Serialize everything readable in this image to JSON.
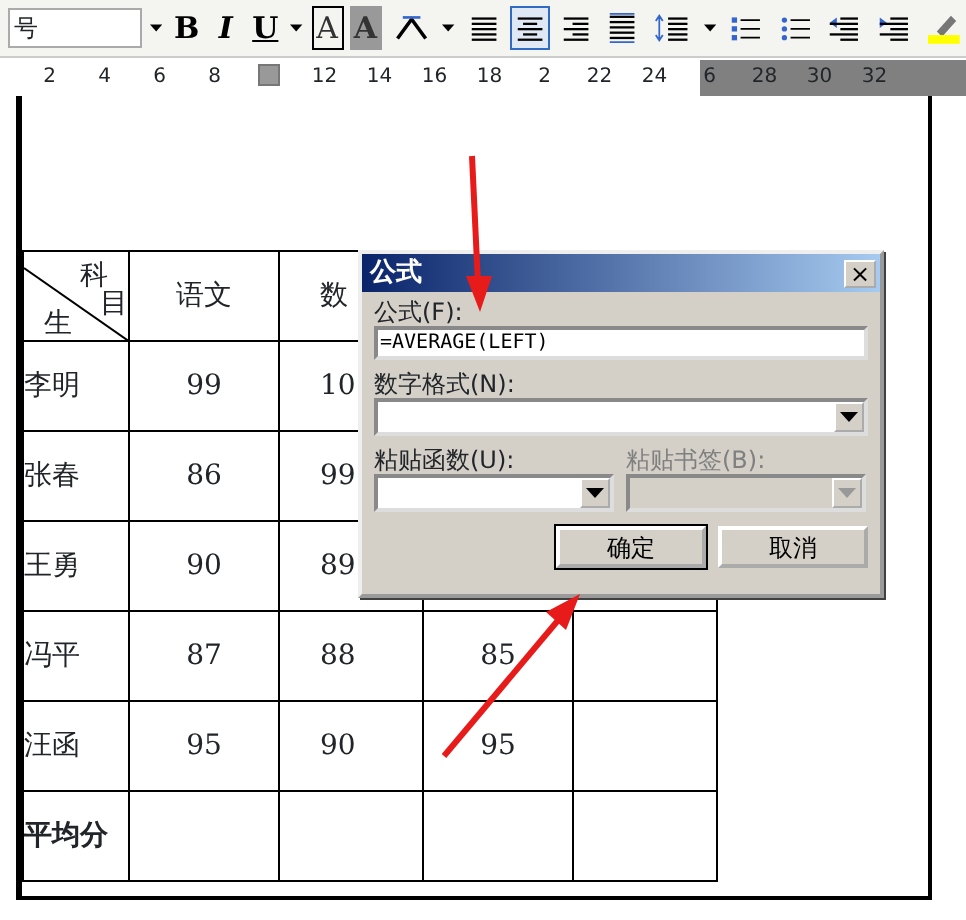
{
  "toolbar": {
    "font_size": "号",
    "items": [
      {
        "kind": "dropdown",
        "selected": false
      },
      {
        "kind": "bold",
        "label": "B",
        "selected": false
      },
      {
        "kind": "italic",
        "label": "I",
        "selected": false
      },
      {
        "kind": "underline",
        "label": "U",
        "selected": false
      },
      {
        "kind": "dropdown",
        "selected": false
      },
      {
        "kind": "boxed",
        "label": "A",
        "selected": false
      },
      {
        "kind": "shaded",
        "label": "A",
        "selected": false
      },
      {
        "kind": "scale",
        "selected": false
      },
      {
        "kind": "dropdown",
        "selected": false
      },
      {
        "kind": "justify",
        "selected": false
      },
      {
        "kind": "center",
        "selected": true
      },
      {
        "kind": "right",
        "selected": false
      },
      {
        "kind": "distribute",
        "selected": false
      },
      {
        "kind": "spacing",
        "selected": false
      },
      {
        "kind": "dropdown",
        "selected": false
      },
      {
        "kind": "numbered",
        "selected": false
      },
      {
        "kind": "bulleted",
        "selected": false
      },
      {
        "kind": "outdent",
        "selected": false
      },
      {
        "kind": "indent",
        "selected": false
      },
      {
        "kind": "highlight",
        "selected": false
      }
    ]
  },
  "ruler": [
    {
      "kind": "number",
      "label": "2"
    },
    {
      "kind": "number",
      "label": "4"
    },
    {
      "kind": "number",
      "label": "6"
    },
    {
      "kind": "number",
      "label": "8"
    },
    {
      "kind": "marker"
    },
    {
      "kind": "number",
      "label": "12"
    },
    {
      "kind": "number",
      "label": "14"
    },
    {
      "kind": "number",
      "label": "16"
    },
    {
      "kind": "number",
      "label": "18"
    },
    {
      "kind": "number",
      "label": "2"
    },
    {
      "kind": "number",
      "label": "22"
    },
    {
      "kind": "number",
      "label": "24"
    },
    {
      "kind": "number",
      "label": "6"
    },
    {
      "kind": "number",
      "label": "28"
    },
    {
      "kind": "number",
      "label": "30"
    },
    {
      "kind": "number",
      "label": "32"
    }
  ],
  "table": {
    "corner": {
      "top": "科",
      "right": "目",
      "bottom": "生"
    },
    "columns": [
      "语文",
      "数"
    ],
    "rows": [
      {
        "kind": "student",
        "name": "李明",
        "cells": [
          "99",
          "10"
        ]
      },
      {
        "kind": "student",
        "name": "张春",
        "cells": [
          "86",
          "99"
        ]
      },
      {
        "kind": "student",
        "name": "王勇",
        "cells": [
          "90",
          "89"
        ]
      },
      {
        "kind": "student",
        "name": "冯平",
        "cells": [
          "87",
          "88",
          "85"
        ]
      },
      {
        "kind": "student",
        "name": "汪函",
        "cells": [
          "95",
          "90",
          "95"
        ]
      },
      {
        "kind": "summary",
        "name": "平均分",
        "cells": []
      }
    ]
  },
  "dialog": {
    "title": "公式",
    "close": "×",
    "formula_label": "公式(F):",
    "formula_value": "=AVERAGE(LEFT)",
    "format_label": "数字格式(N):",
    "function_label": "粘贴函数(U):",
    "bookmark_label": "粘贴书签(B):",
    "bookmark_disabled": true,
    "buttons": [
      {
        "label": "确定",
        "default": true
      },
      {
        "label": "取消",
        "default": false
      }
    ]
  }
}
